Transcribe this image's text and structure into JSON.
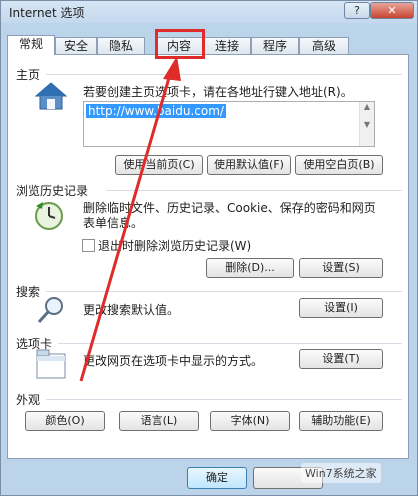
{
  "window": {
    "title": "Internet 选项",
    "help": "?",
    "close": "✕"
  },
  "tabs": [
    "常规",
    "安全",
    "隐私",
    "内容",
    "连接",
    "程序",
    "高级"
  ],
  "home": {
    "label": "主页",
    "desc": "若要创建主页选项卡，请在各地址行键入地址(R)。",
    "url": "http://www.baidu.com/",
    "buttons": [
      "使用当前页(C)",
      "使用默认值(F)",
      "使用空白页(B)"
    ]
  },
  "history": {
    "label": "浏览历史记录",
    "desc1": "删除临时文件、历史记录、Cookie、保存的密码和网页",
    "desc2": "表单信息。",
    "checkbox": "退出时删除浏览历史记录(W)",
    "buttons": [
      "删除(D)...",
      "设置(S)"
    ]
  },
  "search": {
    "label": "搜索",
    "desc": "更改搜索默认值。",
    "button": "设置(I)"
  },
  "tabsSec": {
    "label": "选项卡",
    "desc": "更改网页在选项卡中显示的方式。",
    "button": "设置(T)"
  },
  "appearance": {
    "label": "外观",
    "buttons": [
      "颜色(O)",
      "语言(L)",
      "字体(N)",
      "辅助功能(E)"
    ]
  },
  "footer": {
    "ok": "确定",
    "watermark": "Win7系统之家"
  },
  "colors": {
    "annotation": "#e02b2b",
    "selection": "#3399ff"
  }
}
